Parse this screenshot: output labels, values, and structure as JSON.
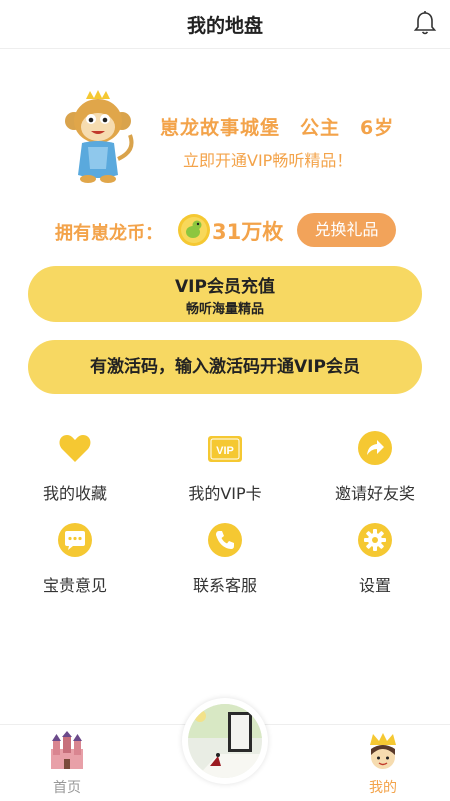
{
  "header": {
    "title": "我的地盘",
    "bell_icon": "bell-icon"
  },
  "profile": {
    "avatar_icon": "monkey-mascot-avatar",
    "story_name": "崽龙故事城堡",
    "role": "公主",
    "age": "6岁",
    "promo": "立即开通VIP畅听精品！"
  },
  "coins": {
    "label": "拥有崽龙币：",
    "value": "31万枚",
    "coin_icon": "coin-bird-icon",
    "redeem_label": "兑换礼品"
  },
  "vip_button": {
    "title": "VIP会员充值",
    "subtitle": "畅听海量精品"
  },
  "activate_button": {
    "label": "有激活码，输入激活码开通VIP会员"
  },
  "menu": [
    {
      "label": "我的收藏",
      "icon": "heart-icon"
    },
    {
      "label": "我的VIP卡",
      "icon": "vip-card-icon"
    },
    {
      "label": "邀请好友奖",
      "icon": "share-icon"
    },
    {
      "label": "宝贵意见",
      "icon": "chat-bubble-icon"
    },
    {
      "label": "联系客服",
      "icon": "phone-icon"
    },
    {
      "label": "设置",
      "icon": "gear-icon"
    }
  ],
  "tabbar": {
    "home_label": "首页",
    "mine_label": "我的",
    "home_icon": "castle-icon",
    "mine_icon": "crowned-kid-icon",
    "center_icon": "story-door-play-button"
  },
  "colors": {
    "accent_orange": "#f3a34a",
    "button_yellow": "#f7d862",
    "icon_yellow": "#f5c832"
  }
}
